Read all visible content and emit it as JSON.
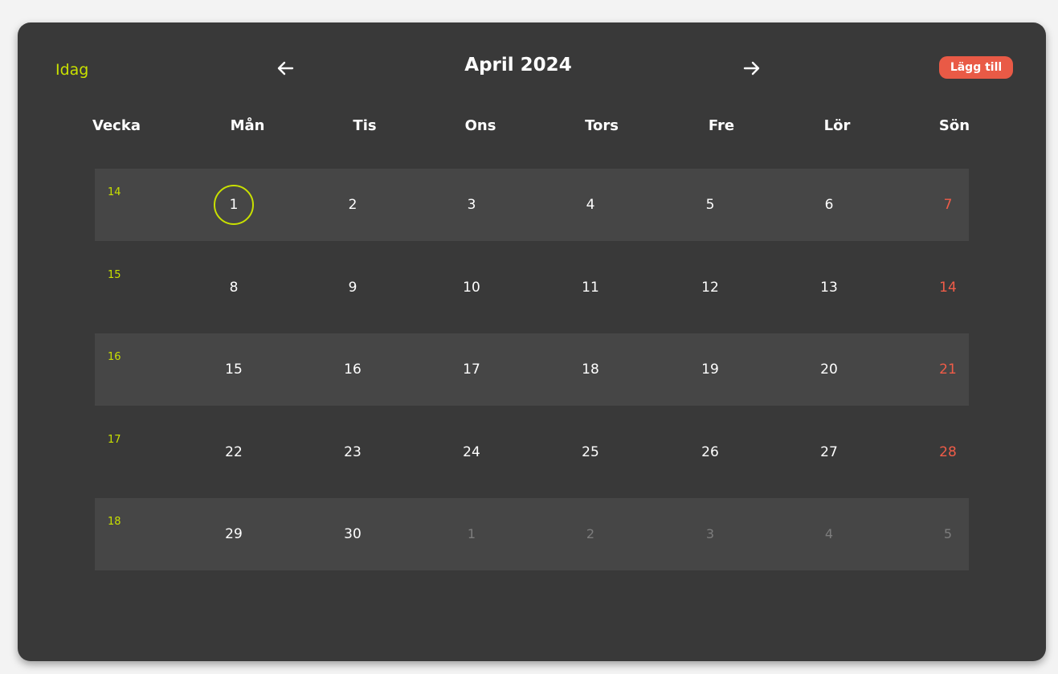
{
  "header": {
    "today_label": "Idag",
    "month_title": "April 2024",
    "add_label": "Lägg till",
    "prev_icon": "arrow-left-icon",
    "next_icon": "arrow-right-icon"
  },
  "colors": {
    "accent": "#c8e000",
    "sunday": "#f05c48",
    "button": "#e95a46",
    "card_bg": "#393939",
    "row_shade": "#464646",
    "muted": "#7d7d7d"
  },
  "columns": [
    "Vecka",
    "Mån",
    "Tis",
    "Ons",
    "Tors",
    "Fre",
    "Lör",
    "Sön"
  ],
  "weeks": [
    {
      "week": "14",
      "days": [
        {
          "d": "1",
          "today": true
        },
        {
          "d": "2"
        },
        {
          "d": "3"
        },
        {
          "d": "4"
        },
        {
          "d": "5"
        },
        {
          "d": "6"
        },
        {
          "d": "7"
        }
      ]
    },
    {
      "week": "15",
      "days": [
        {
          "d": "8"
        },
        {
          "d": "9"
        },
        {
          "d": "10"
        },
        {
          "d": "11"
        },
        {
          "d": "12"
        },
        {
          "d": "13"
        },
        {
          "d": "14"
        }
      ]
    },
    {
      "week": "16",
      "days": [
        {
          "d": "15"
        },
        {
          "d": "16"
        },
        {
          "d": "17"
        },
        {
          "d": "18"
        },
        {
          "d": "19"
        },
        {
          "d": "20"
        },
        {
          "d": "21"
        }
      ]
    },
    {
      "week": "17",
      "days": [
        {
          "d": "22"
        },
        {
          "d": "23"
        },
        {
          "d": "24"
        },
        {
          "d": "25"
        },
        {
          "d": "26"
        },
        {
          "d": "27"
        },
        {
          "d": "28"
        }
      ]
    },
    {
      "week": "18",
      "days": [
        {
          "d": "29"
        },
        {
          "d": "30"
        },
        {
          "d": "1",
          "other": true
        },
        {
          "d": "2",
          "other": true
        },
        {
          "d": "3",
          "other": true
        },
        {
          "d": "4",
          "other": true
        },
        {
          "d": "5",
          "other": true
        }
      ]
    }
  ]
}
